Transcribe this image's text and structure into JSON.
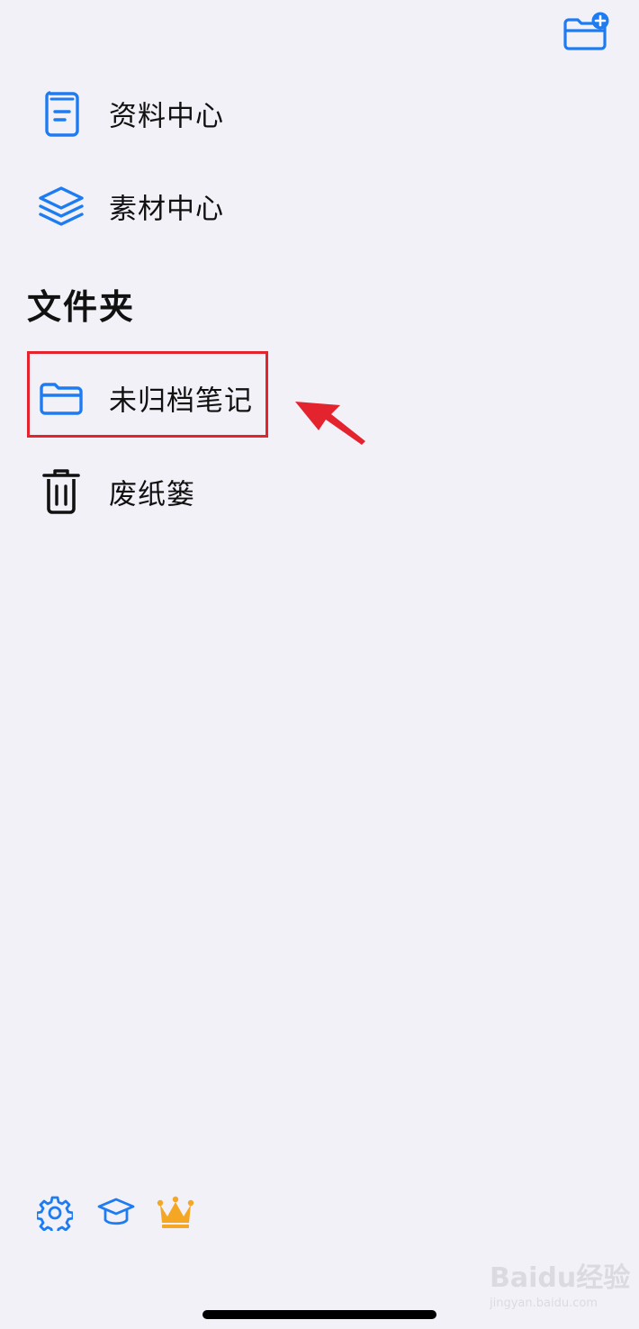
{
  "sidebar": {
    "items": [
      {
        "label": "资料中心",
        "icon": "document-book-icon"
      },
      {
        "label": "素材中心",
        "icon": "layers-icon"
      }
    ],
    "folders_title": "文件夹",
    "folders": [
      {
        "label": "未归档笔记",
        "icon": "folder-icon",
        "highlighted": true
      },
      {
        "label": "废纸篓",
        "icon": "trash-icon"
      }
    ]
  },
  "header": {
    "new_folder_icon": "folder-plus-icon"
  },
  "footer": {
    "icons": [
      "gear-icon",
      "graduation-cap-icon",
      "crown-icon"
    ]
  },
  "colors": {
    "accent": "#1e7cf2",
    "background": "#f2f1f7",
    "highlight": "#e3242f",
    "crown": "#f5a623"
  },
  "watermark": {
    "brand": "Baidu经验",
    "url": "jingyan.baidu.com"
  }
}
